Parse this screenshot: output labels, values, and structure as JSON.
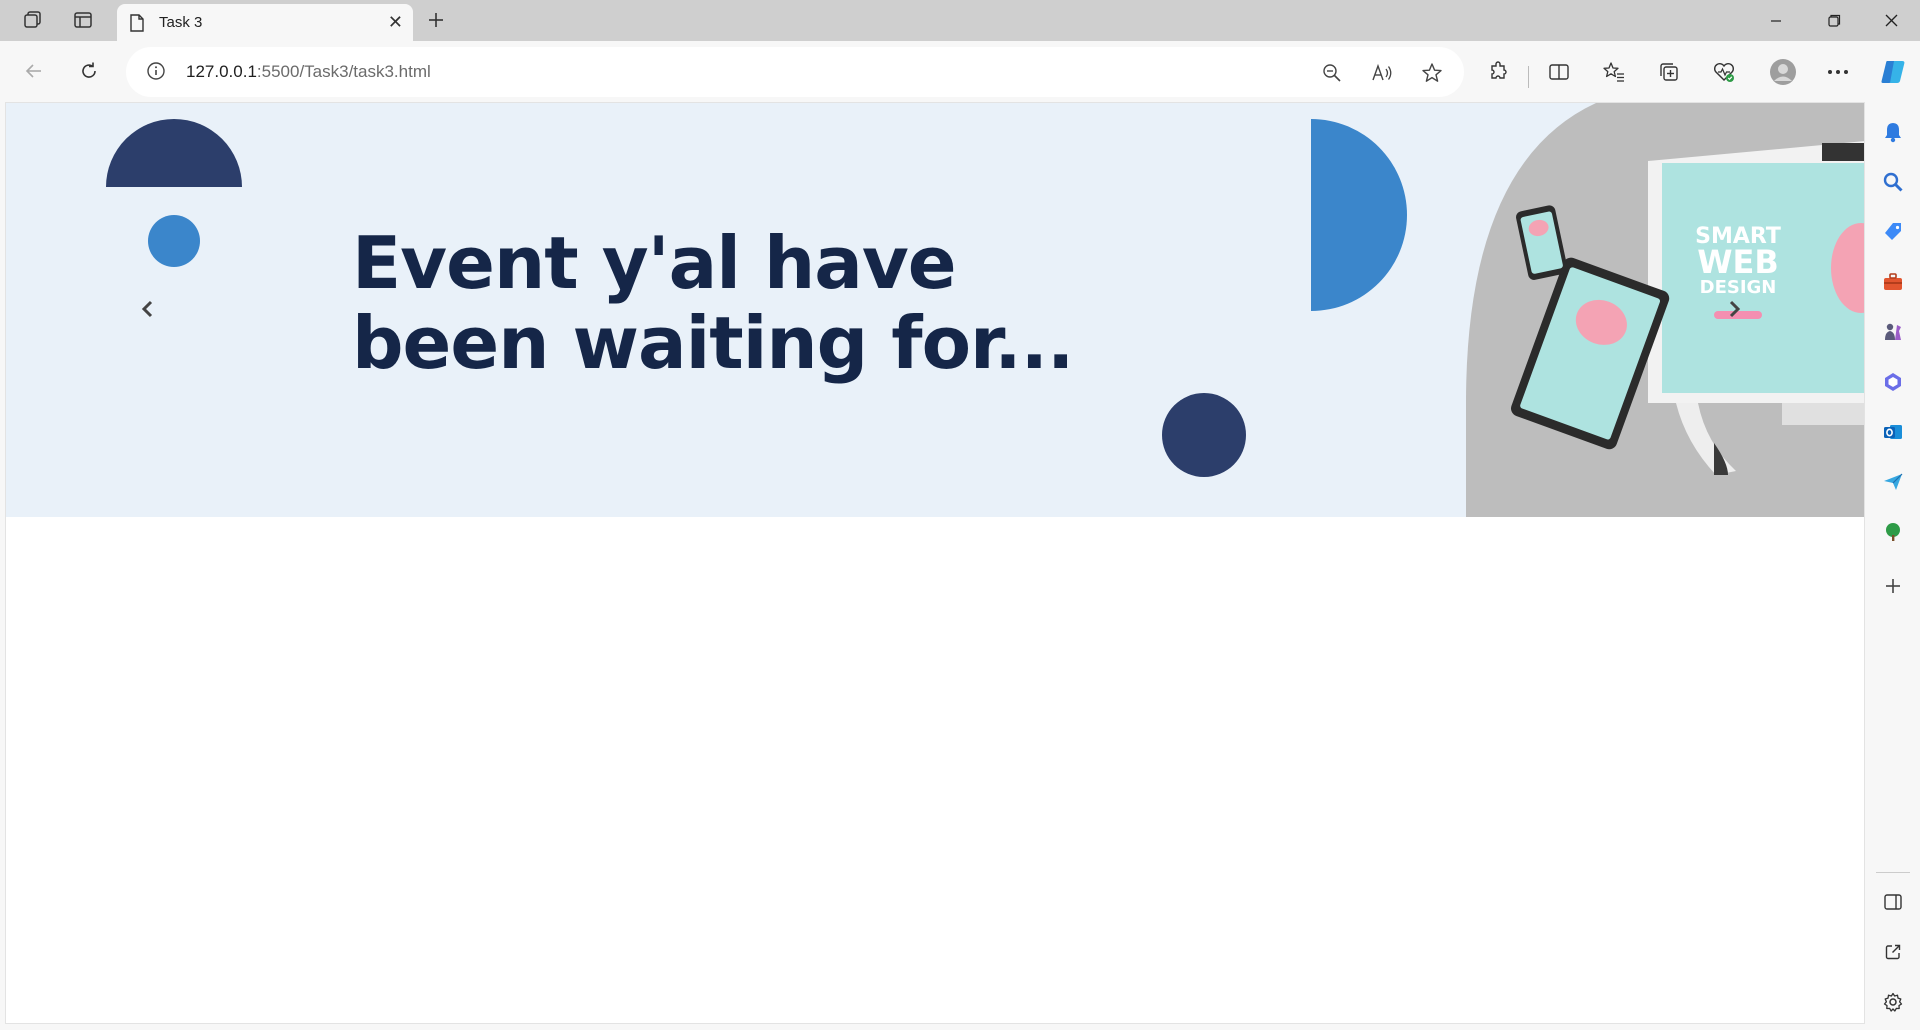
{
  "browser": {
    "tab": {
      "title": "Task 3"
    },
    "url": {
      "host": "127.0.0.1",
      "path": ":5500/Task3/task3.html"
    }
  },
  "page": {
    "headline_line1": "Event y'al have",
    "headline_line2": "been waiting for...",
    "device_image": {
      "monitor_text_1": "SMART",
      "monitor_text_2": "WEB",
      "monitor_text_3": "DESIGN"
    }
  },
  "colors": {
    "hero_bg": "#e9f1f9",
    "navy": "#2c3e6b",
    "blue": "#3b86cb",
    "headline": "#152648"
  }
}
